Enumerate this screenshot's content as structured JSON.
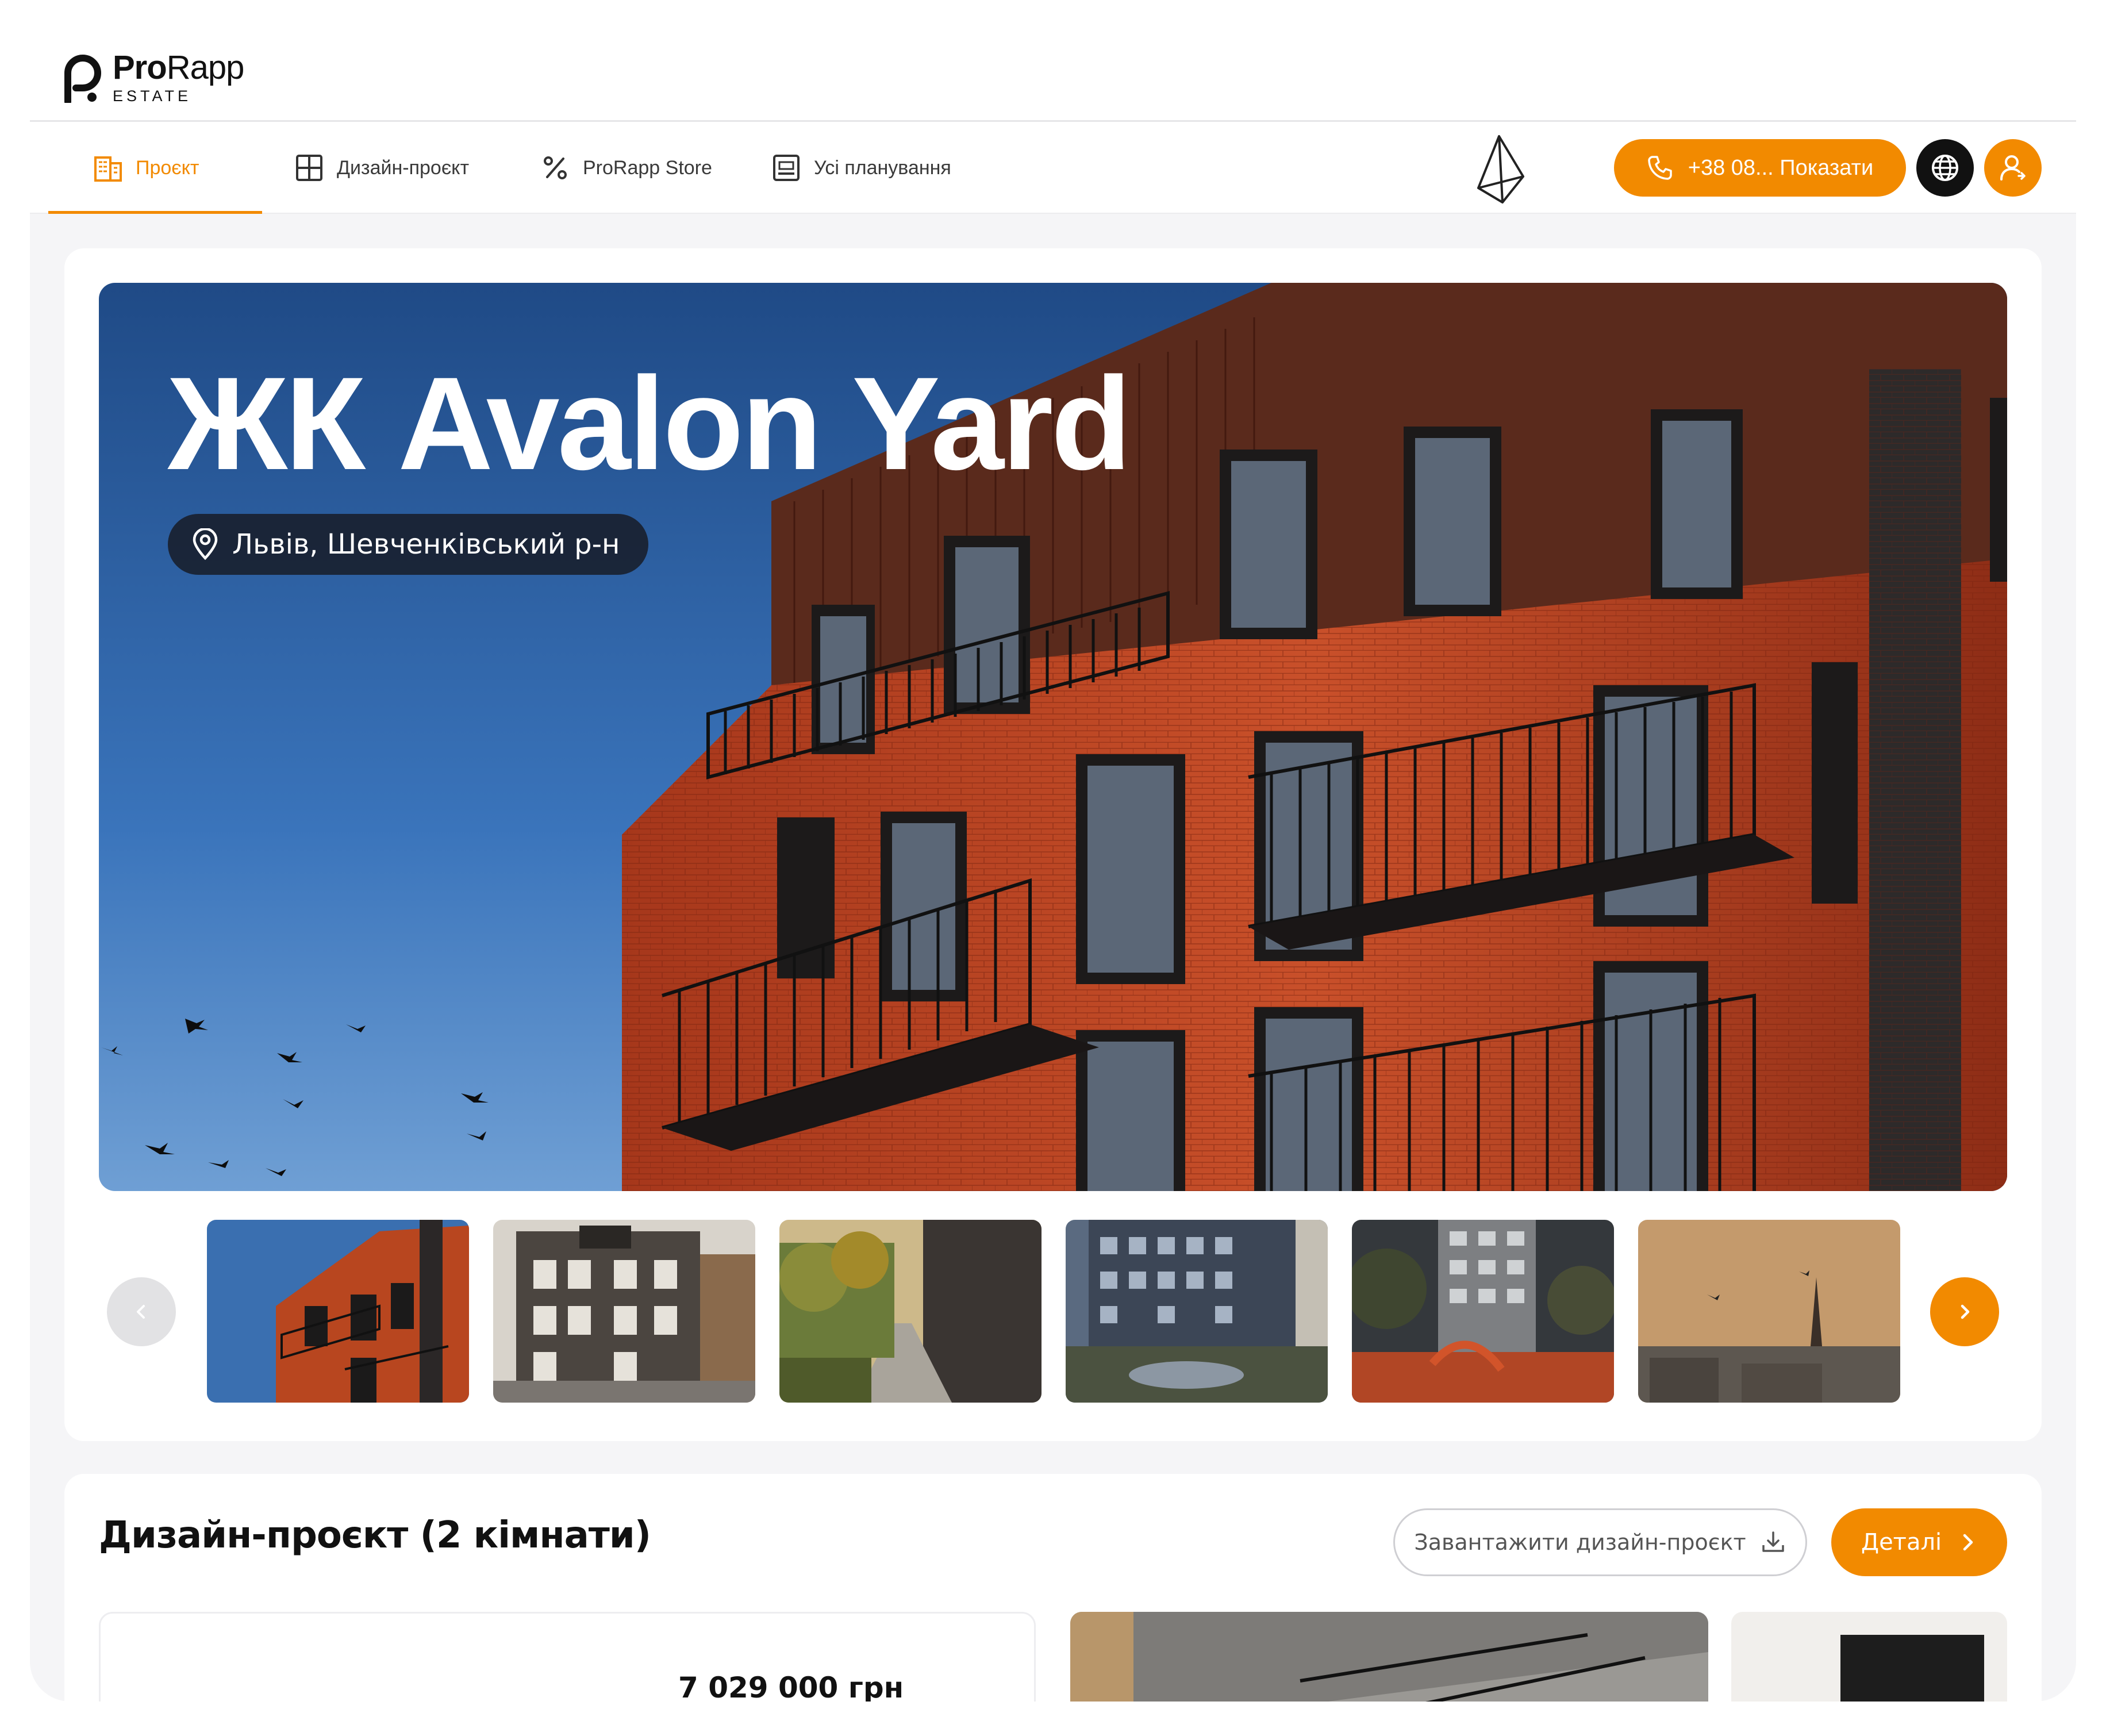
{
  "header": {
    "logo_name_bold": "Pro",
    "logo_name_light": "Rapp",
    "logo_sub": "ESTATE"
  },
  "nav": {
    "tabs": [
      {
        "label": "Проєкт",
        "icon": "building-icon",
        "active": true
      },
      {
        "label": "Дизайн-проєкт",
        "icon": "grid-icon",
        "active": false
      },
      {
        "label": "ProRapp Store",
        "icon": "percent-icon",
        "active": false
      },
      {
        "label": "Усі планування",
        "icon": "floorplan-icon",
        "active": false
      }
    ],
    "phone_label": "+38 08... Показати",
    "accent_color": "#f28a00"
  },
  "hero": {
    "title": "ЖК Avalon Yard",
    "location": "Львів, Шевченківський р-н"
  },
  "gallery": {
    "thumbnails": [
      "facade-red-brick",
      "facade-grey",
      "alley-trees",
      "courtyard-night",
      "playground",
      "city-sunset"
    ]
  },
  "design_section": {
    "title": "Дизайн-проєкт (2 кімнати)",
    "download_label": "Завантажити дизайн-проєкт",
    "details_label": "Деталі",
    "price": "7 029 000 грн"
  }
}
